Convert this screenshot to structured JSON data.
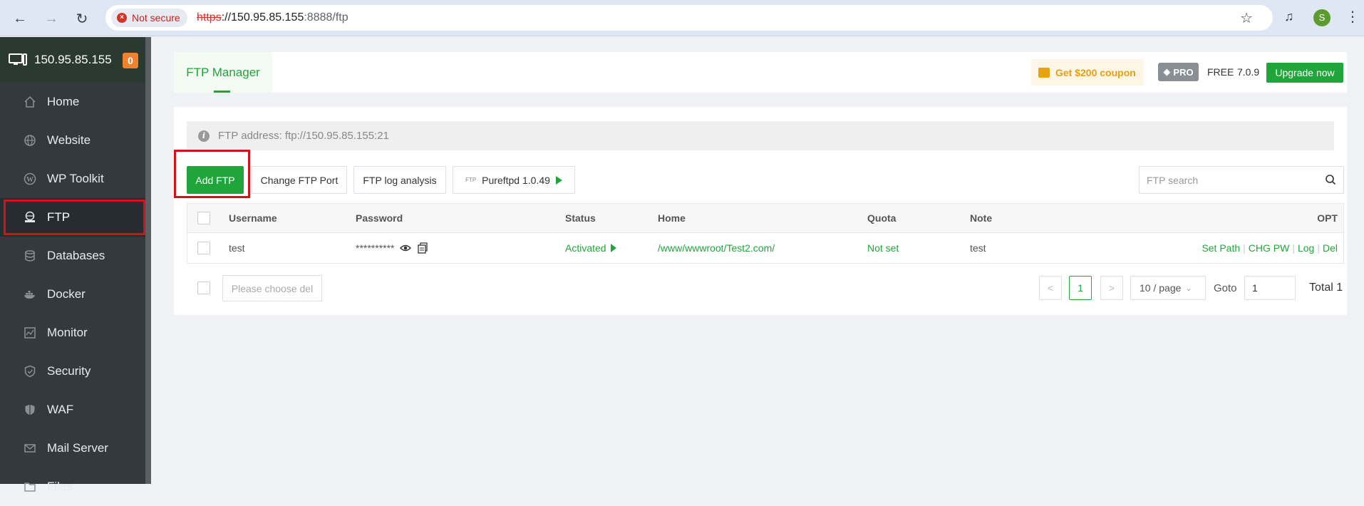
{
  "browser": {
    "security_label": "Not secure",
    "url_scheme": "https",
    "url_host": "://150.95.85.155",
    "url_rest": ":8888/ftp",
    "profile_initial": "S"
  },
  "sidebar": {
    "server_ip": "150.95.85.155",
    "badge": "0",
    "items": [
      {
        "label": "Home",
        "icon": "home-icon"
      },
      {
        "label": "Website",
        "icon": "globe-icon"
      },
      {
        "label": "WP Toolkit",
        "icon": "wordpress-icon"
      },
      {
        "label": "FTP",
        "icon": "ftp-icon"
      },
      {
        "label": "Databases",
        "icon": "database-icon"
      },
      {
        "label": "Docker",
        "icon": "docker-icon"
      },
      {
        "label": "Monitor",
        "icon": "monitor-icon"
      },
      {
        "label": "Security",
        "icon": "shield-icon"
      },
      {
        "label": "WAF",
        "icon": "waf-shield-icon"
      },
      {
        "label": "Mail Server",
        "icon": "mail-icon"
      },
      {
        "label": "Files",
        "icon": "folder-icon"
      }
    ]
  },
  "header": {
    "tab": "FTP Manager",
    "coupon": "Get $200 coupon",
    "pro": "PRO",
    "edition": "FREE",
    "version": "7.0.9",
    "upgrade": "Upgrade now"
  },
  "ftp": {
    "address": "FTP address: ftp://150.95.85.155:21",
    "buttons": {
      "add": "Add FTP",
      "port": "Change FTP Port",
      "log": "FTP log analysis",
      "pure_tag": "FTP",
      "pure": "Pureftpd 1.0.49"
    },
    "search_placeholder": "FTP search",
    "columns": [
      "Username",
      "Password",
      "Status",
      "Home",
      "Quota",
      "Note",
      "OPT"
    ],
    "rows": [
      {
        "username": "test",
        "password": "**********",
        "status": "Activated",
        "home": "/www/wwwroot/Test2.com/",
        "quota": "Not set",
        "note": "test",
        "ops": [
          "Set Path",
          "CHG PW",
          "Log",
          "Del"
        ]
      }
    ],
    "footer": {
      "batch_placeholder": "Please choose del",
      "prev": "<",
      "page": "1",
      "next": ">",
      "per_page": "10 / page",
      "goto_label": "Goto",
      "goto_value": "1",
      "total": "Total 1"
    }
  },
  "colors": {
    "accent": "#20a53a",
    "sidebar_bg": "#333a3e",
    "highlight_box": "#d0121b",
    "coupon": "#e8a10d"
  }
}
